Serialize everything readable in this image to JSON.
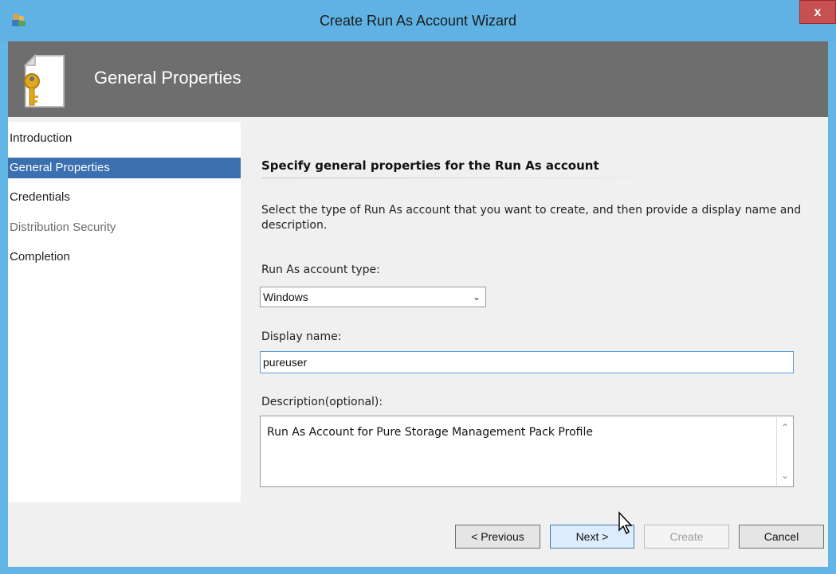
{
  "window": {
    "title": "Create Run As Account Wizard",
    "close_label": "x"
  },
  "header": {
    "title": "General Properties",
    "icon": "key-document-icon"
  },
  "nav": {
    "items": [
      {
        "label": "Introduction",
        "state": "normal"
      },
      {
        "label": "General Properties",
        "state": "selected"
      },
      {
        "label": "Credentials",
        "state": "normal"
      },
      {
        "label": "Distribution Security",
        "state": "disabled"
      },
      {
        "label": "Completion",
        "state": "normal"
      }
    ]
  },
  "main": {
    "heading": "Specify general properties for the Run As account",
    "intro": "Select the type of Run As account that you want to create, and then provide a display name and description.",
    "account_type": {
      "label": "Run As account type:",
      "value": "Windows"
    },
    "display_name": {
      "label": "Display name:",
      "value": "pureuser"
    },
    "description": {
      "label": "Description(optional):",
      "value": "Run As Account for Pure Storage Management Pack Profile"
    }
  },
  "buttons": {
    "previous": "< Previous",
    "next": "Next >",
    "create": "Create",
    "cancel": "Cancel"
  },
  "colors": {
    "titlebar": "#5fb2e3",
    "header": "#6e6e6e",
    "nav_selected": "#3a6fb0",
    "close": "#c75050"
  }
}
